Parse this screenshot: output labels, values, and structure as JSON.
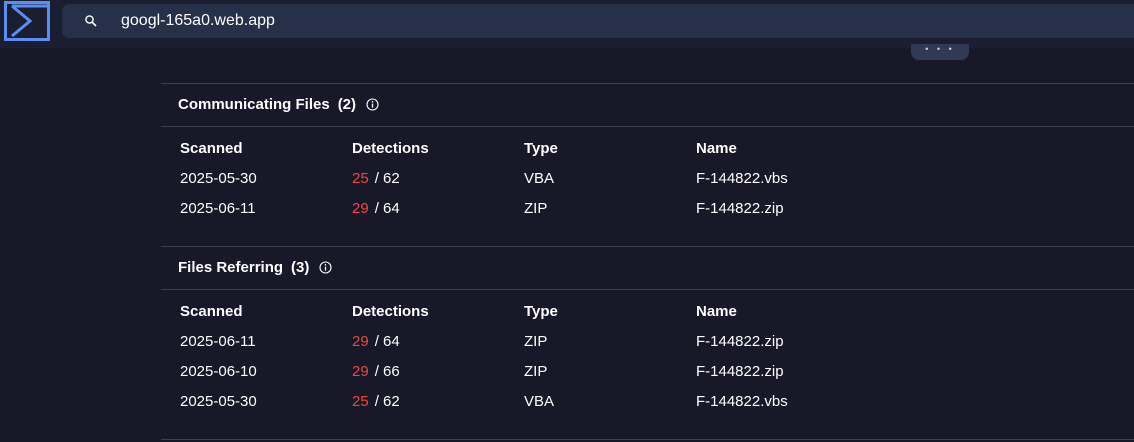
{
  "header": {
    "search_value": "googl-165a0.web.app",
    "logo_icon": "sigma-logo-icon",
    "search_icon": "search-icon",
    "more_label": "• • •"
  },
  "sections": [
    {
      "title": "Communicating Files",
      "count": "(2)",
      "columns": [
        "Scanned",
        "Detections",
        "Type",
        "Name"
      ],
      "rows": [
        {
          "scanned": "2025-05-30",
          "positives": "25",
          "total": "/ 62",
          "type": "VBA",
          "name": "F-144822.vbs"
        },
        {
          "scanned": "2025-06-11",
          "positives": "29",
          "total": "/ 64",
          "type": "ZIP",
          "name": "F-144822.zip"
        }
      ]
    },
    {
      "title": "Files Referring",
      "count": "(3)",
      "columns": [
        "Scanned",
        "Detections",
        "Type",
        "Name"
      ],
      "rows": [
        {
          "scanned": "2025-06-11",
          "positives": "29",
          "total": "/ 64",
          "type": "ZIP",
          "name": "F-144822.zip"
        },
        {
          "scanned": "2025-06-10",
          "positives": "29",
          "total": "/ 66",
          "type": "ZIP",
          "name": "F-144822.zip"
        },
        {
          "scanned": "2025-05-30",
          "positives": "25",
          "total": "/ 62",
          "type": "VBA",
          "name": "F-144822.vbs"
        }
      ]
    }
  ],
  "colors": {
    "background": "#181828",
    "search_bg": "#263049",
    "accent_logo": "#5b8ef5",
    "detection_positive": "#f04545"
  }
}
